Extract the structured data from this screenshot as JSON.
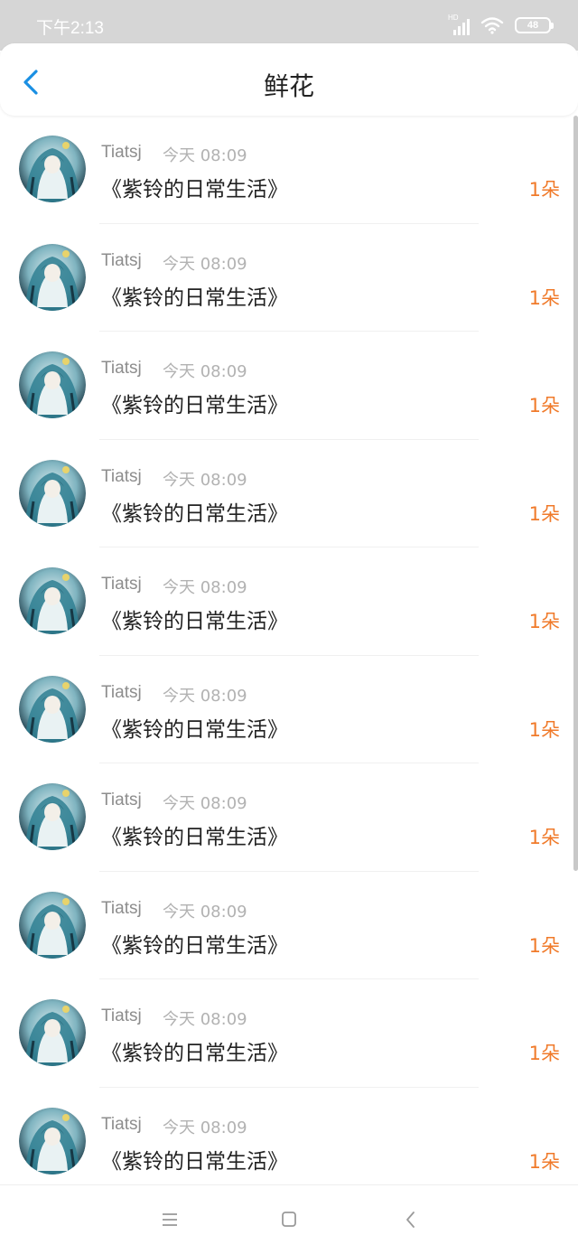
{
  "status": {
    "time": "下午2:13",
    "network": "HD",
    "battery": "48"
  },
  "header": {
    "title": "鲜花"
  },
  "colors": {
    "accent": "#1a8fe3",
    "count": "#f07a2a"
  },
  "icons": {
    "back": "chevron-left",
    "menu": "menu",
    "home": "square",
    "nav_back": "chevron-left"
  },
  "items": [
    {
      "user": "Tiatsj",
      "time": "今天 08:09",
      "book": "《紫铃的日常生活》",
      "count": "1朵"
    },
    {
      "user": "Tiatsj",
      "time": "今天 08:09",
      "book": "《紫铃的日常生活》",
      "count": "1朵"
    },
    {
      "user": "Tiatsj",
      "time": "今天 08:09",
      "book": "《紫铃的日常生活》",
      "count": "1朵"
    },
    {
      "user": "Tiatsj",
      "time": "今天 08:09",
      "book": "《紫铃的日常生活》",
      "count": "1朵"
    },
    {
      "user": "Tiatsj",
      "time": "今天 08:09",
      "book": "《紫铃的日常生活》",
      "count": "1朵"
    },
    {
      "user": "Tiatsj",
      "time": "今天 08:09",
      "book": "《紫铃的日常生活》",
      "count": "1朵"
    },
    {
      "user": "Tiatsj",
      "time": "今天 08:09",
      "book": "《紫铃的日常生活》",
      "count": "1朵"
    },
    {
      "user": "Tiatsj",
      "time": "今天 08:09",
      "book": "《紫铃的日常生活》",
      "count": "1朵"
    },
    {
      "user": "Tiatsj",
      "time": "今天 08:09",
      "book": "《紫铃的日常生活》",
      "count": "1朵"
    },
    {
      "user": "Tiatsj",
      "time": "今天 08:09",
      "book": "《紫铃的日常生活》",
      "count": "1朵"
    }
  ]
}
